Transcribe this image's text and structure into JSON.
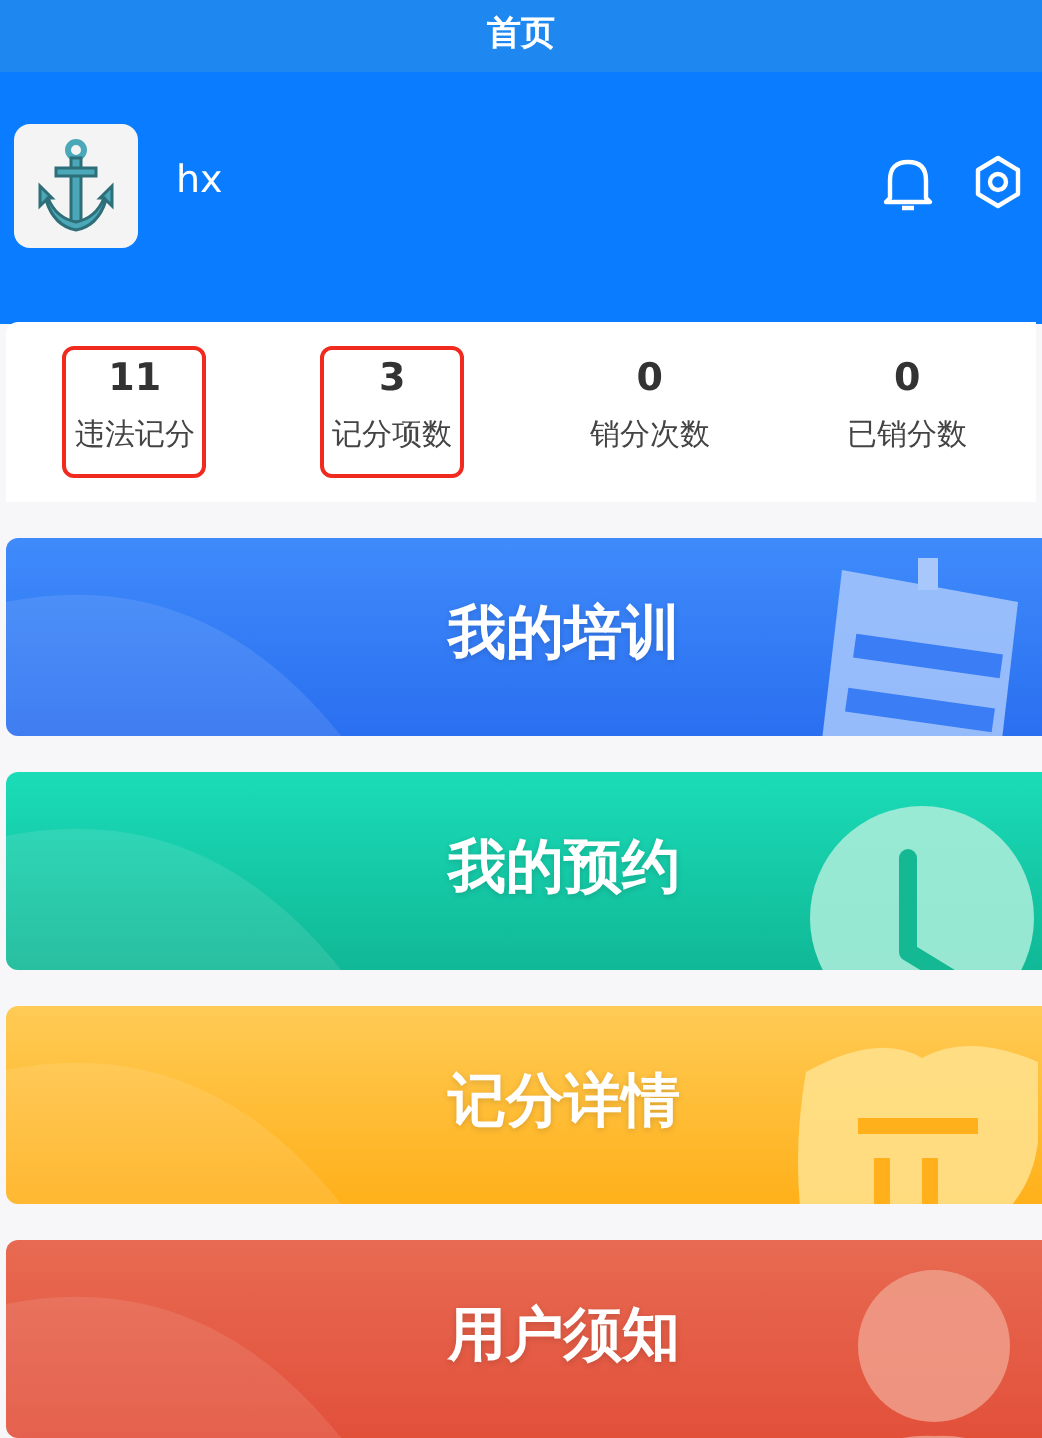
{
  "window": {
    "title": "首页"
  },
  "profile": {
    "name": "hx"
  },
  "stats": [
    {
      "value": "11",
      "label": "违法记分",
      "highlighted": true
    },
    {
      "value": "3",
      "label": "记分项数",
      "highlighted": true
    },
    {
      "value": "0",
      "label": "销分次数",
      "highlighted": false
    },
    {
      "value": "0",
      "label": "已销分数",
      "highlighted": false
    }
  ],
  "menu": [
    {
      "label": "我的培训",
      "kind": "document"
    },
    {
      "label": "我的预约",
      "kind": "clock"
    },
    {
      "label": "记分详情",
      "kind": "shield"
    },
    {
      "label": "用户须知",
      "kind": "person"
    }
  ]
}
